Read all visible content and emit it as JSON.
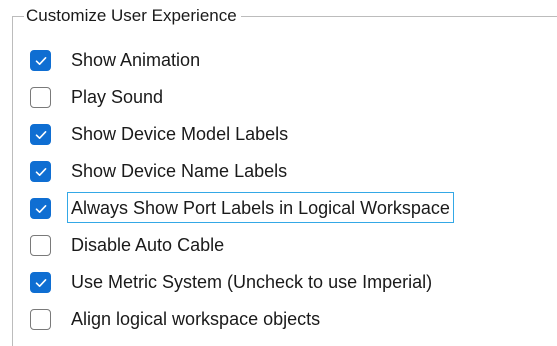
{
  "group": {
    "title": "Customize User Experience"
  },
  "options": [
    {
      "label": "Show Animation",
      "checked": true,
      "focused": false
    },
    {
      "label": "Play Sound",
      "checked": false,
      "focused": false
    },
    {
      "label": "Show Device Model Labels",
      "checked": true,
      "focused": false
    },
    {
      "label": "Show Device Name Labels",
      "checked": true,
      "focused": false
    },
    {
      "label": "Always Show Port Labels in Logical Workspace",
      "checked": true,
      "focused": true
    },
    {
      "label": "Disable Auto Cable",
      "checked": false,
      "focused": false
    },
    {
      "label": "Use Metric System (Uncheck to use Imperial)",
      "checked": true,
      "focused": false
    },
    {
      "label": "Align logical workspace objects",
      "checked": false,
      "focused": false
    }
  ],
  "colors": {
    "checkbox_fill": "#0f6ed2",
    "focus_outline": "#34a8e6",
    "group_border": "#bcbcbc"
  },
  "icons": {
    "checked": "checkmark-icon"
  }
}
